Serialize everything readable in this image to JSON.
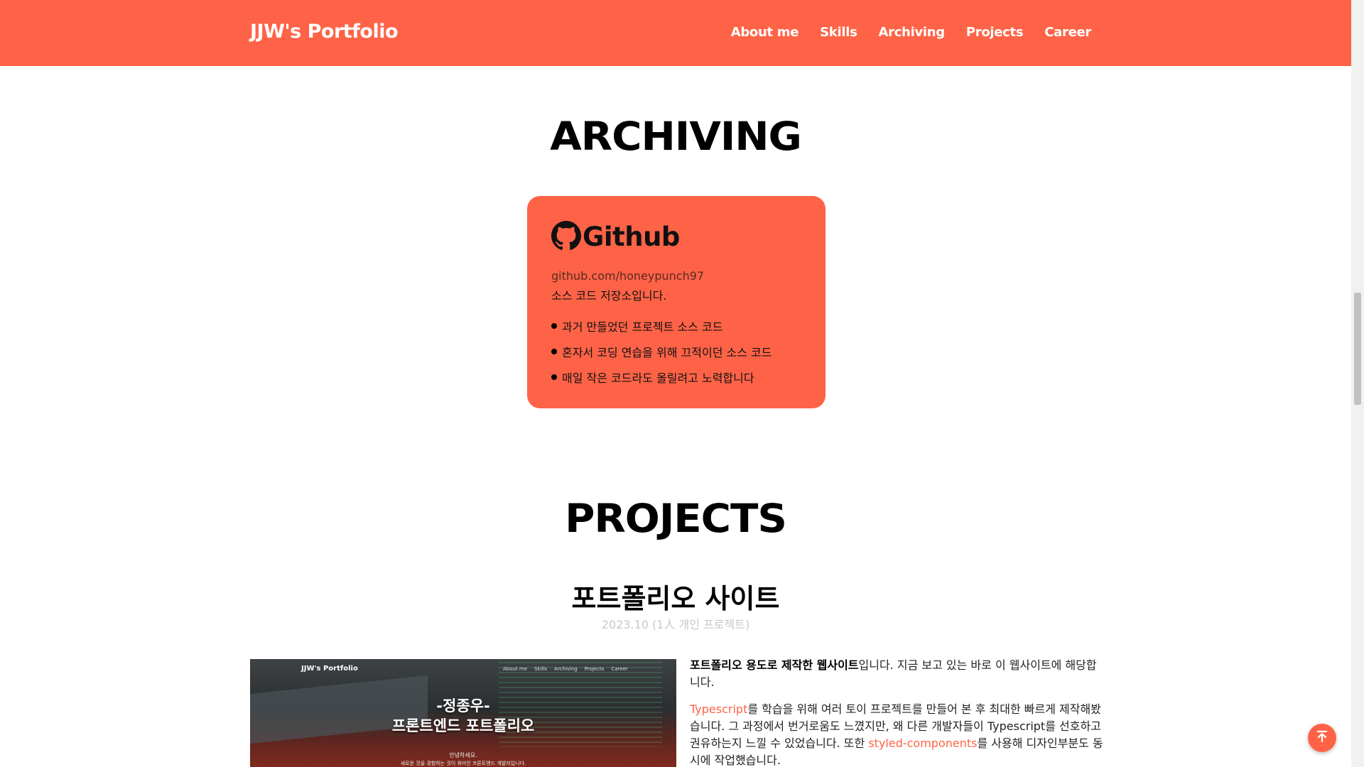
{
  "header": {
    "brand": "JJW's Portfolio",
    "nav": [
      "About me",
      "Skills",
      "Archiving",
      "Projects",
      "Career"
    ]
  },
  "archiving": {
    "title": "ARCHIVING",
    "card": {
      "icon": "github-icon",
      "title": "Github",
      "link": "github.com/honeypunch97",
      "description": "소스 코드 저장소입니다.",
      "items": [
        "과거 만들었던 프로젝트 소스 코드",
        "혼자서 코딩 연습을 위해 끄적이던 소스 코드",
        "매일 작은 코드라도 올릴려고 노력합니다"
      ]
    }
  },
  "projects": {
    "title": "PROJECTS",
    "project": {
      "title": "포트폴리오 사이트",
      "meta": "2023.10 (1人 개인 프로젝트)",
      "image": {
        "brand": "JJW's Portfolio",
        "nav": [
          "About me",
          "Skills",
          "Archiving",
          "Projects",
          "Career"
        ],
        "heading1": "-정종우-",
        "heading2": "프론트엔드 포트폴리오",
        "subtitle1": "안녕하세요.",
        "subtitle2": "새로운 것을 경험하는 것이 취미인 프론트엔드 개발자입니다."
      },
      "paragraph1": {
        "strong": "포트폴리오 용도로 제작한 웹사이트",
        "rest": "입니다. 지금 보고 있는 바로 이 웹사이트에 해당합니다."
      },
      "paragraph2": {
        "link1": "Typescript",
        "text1": "를 학습을 위해 여러 토이 프로젝트를 만들어 본 후 최대한 빠르게 제작해봤습니다. 그 과정에서 번거로움도 느꼈지만, 왜 다른 개발자들이 Typescript를 선호하고 권유하는지 느낄 수 있었습니다. 또한 ",
        "link2": "styled-components",
        "text2": "를 사용해 디자인부분도 동시에 작업했습니다."
      }
    }
  },
  "colors": {
    "accent": "#ff6347",
    "card_link": "#5a2a22",
    "meta": "#c8c8c8"
  },
  "scroll_top_button": {
    "icon": "arrow-up-to-top-icon"
  }
}
